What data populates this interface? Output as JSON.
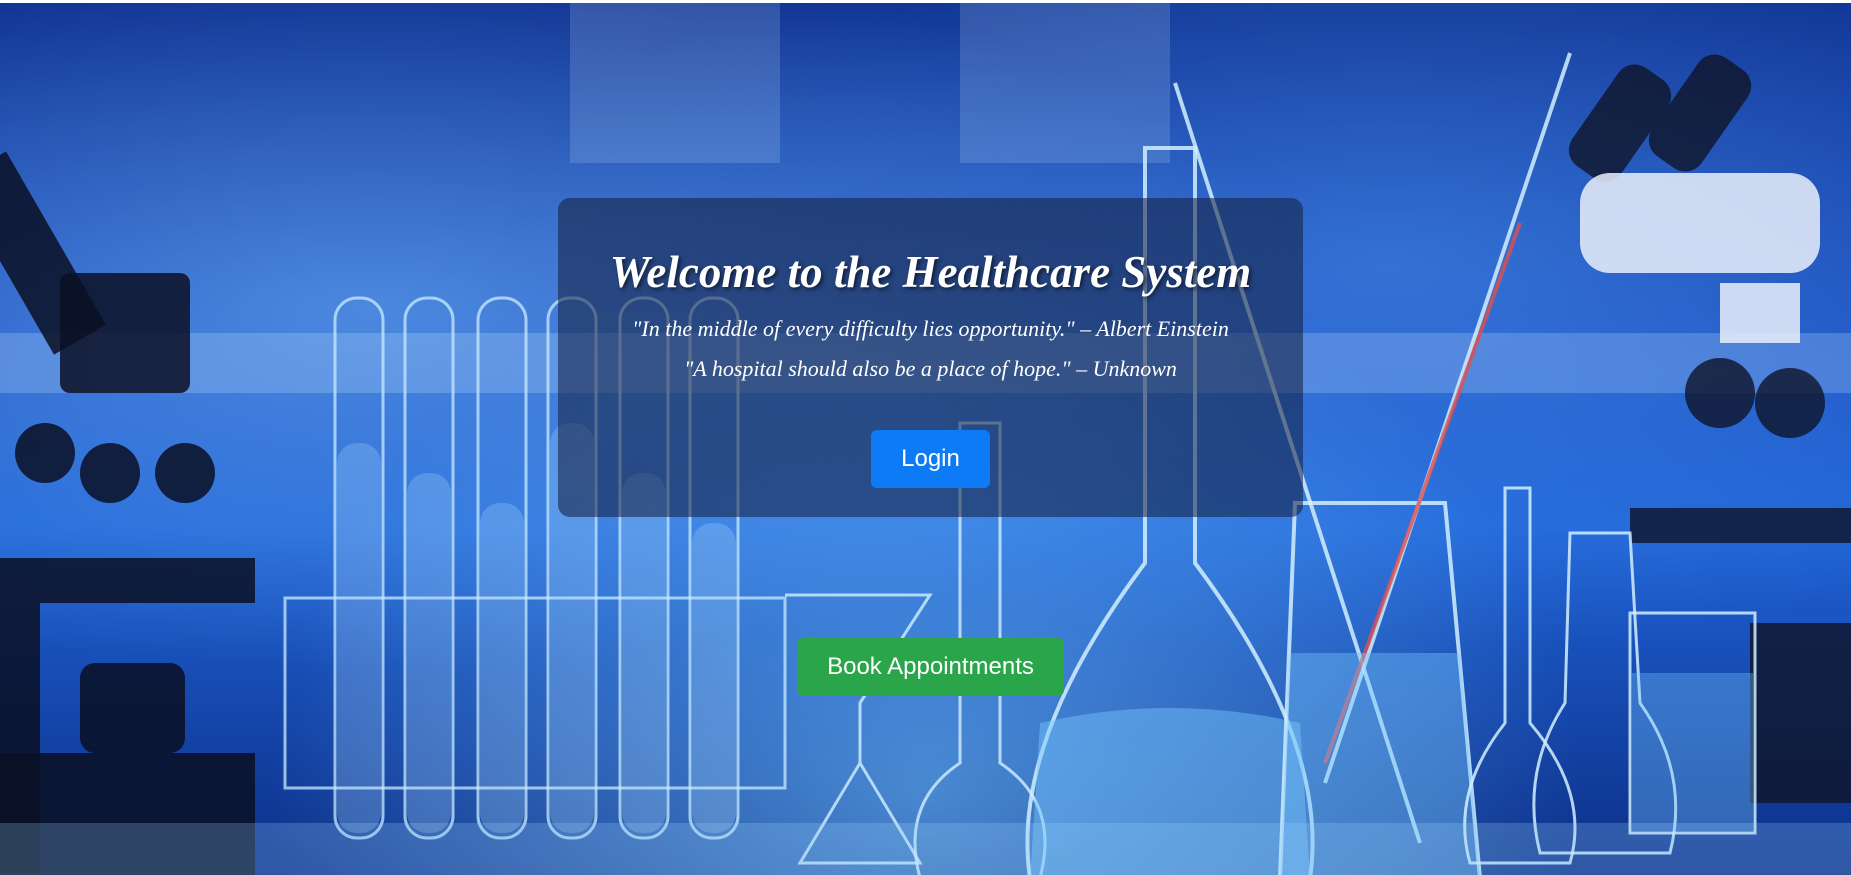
{
  "hero": {
    "background_description": "laboratory-glassware-background",
    "title": "Welcome to the Healthcare System",
    "quotes": [
      "\"In the middle of every difficulty lies opportunity.\" – Albert Einstein",
      "\"A hospital should also be a place of hope.\" – Unknown"
    ],
    "login_label": "Login",
    "book_label": "Book Appointments"
  },
  "colors": {
    "login_button": "#0d7bf5",
    "book_button": "#2aa54a",
    "card_overlay": "rgba(20, 30, 60, 0.55)",
    "text": "#ffffff"
  }
}
